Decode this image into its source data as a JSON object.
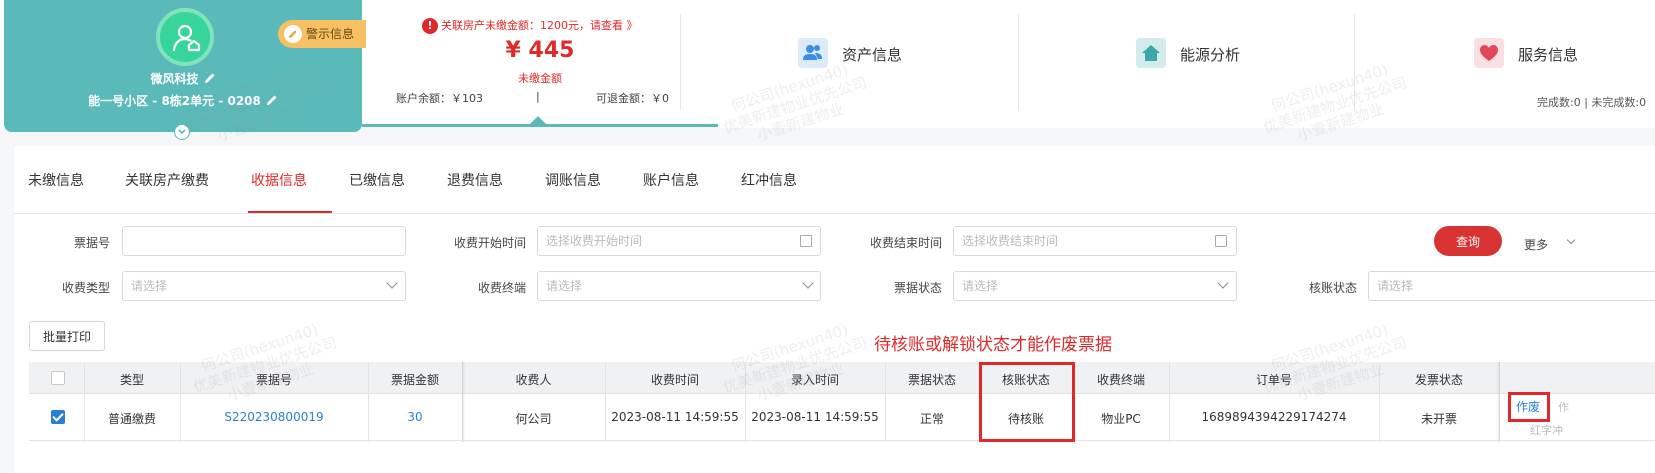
{
  "profile": {
    "name": "微风科技",
    "address": "能一号小区 - 8栋2单元 - 0208",
    "warning_label": "警示信息"
  },
  "unpaid": {
    "alert": "关联房产未缴金额：1200元，请查看 》",
    "amount": "¥ 445",
    "amount_label": "未缴金额",
    "balance": "账户余额：￥103",
    "separator": "|",
    "refundable": "可退金额：￥0"
  },
  "tiles": {
    "assets": "资产信息",
    "energy": "能源分析",
    "service": "服务信息",
    "service_counts": "完成数:0 | 未完成数:0"
  },
  "tabs": [
    "未缴信息",
    "关联房产缴费",
    "收据信息",
    "已缴信息",
    "退费信息",
    "调账信息",
    "账户信息",
    "红冲信息"
  ],
  "active_tab": "收据信息",
  "filters": {
    "receipt_no": {
      "label": "票据号",
      "value": "",
      "placeholder": ""
    },
    "start_time": {
      "label": "收费开始时间",
      "placeholder": "选择收费开始时间"
    },
    "end_time": {
      "label": "收费结束时间",
      "placeholder": "选择收费结束时间"
    },
    "fee_type": {
      "label": "收费类型",
      "placeholder": "请选择"
    },
    "terminal": {
      "label": "收费终端",
      "placeholder": "请选择"
    },
    "receipt_status": {
      "label": "票据状态",
      "placeholder": "请选择"
    },
    "verify_status": {
      "label": "核账状态",
      "placeholder": "请选择"
    },
    "query_label": "查询",
    "more_label": "更多"
  },
  "batch_print": "批量打印",
  "note": "待核账或解锁状态才能作废票据",
  "table": {
    "headers": [
      "类型",
      "票据号",
      "票据金额",
      "收费人",
      "收费时间",
      "录入时间",
      "票据状态",
      "核账状态",
      "收费终端",
      "订单号",
      "发票状态"
    ],
    "rows": [
      {
        "type": "普通缴费",
        "receipt_no": "S220230800019",
        "amount": "30",
        "payee": "何公司",
        "pay_time": "2023-08-11 14:59:55",
        "entry_time": "2023-08-11 14:59:55",
        "receipt_status": "正常",
        "verify_status": "待核账",
        "terminal": "物业PC",
        "order_no": "1689894394229174274",
        "invoice_status": "未开票",
        "action_void": "作废",
        "action_greyed": "作",
        "action_red": "红字冲"
      }
    ]
  },
  "watermark": [
    "何公司(hexun40)",
    "优美新建物业优先公司",
    "小壹新建物业"
  ],
  "colors": {
    "teal": "#5ab9b9",
    "red": "#e02a2a",
    "link": "#2a7fd4"
  }
}
